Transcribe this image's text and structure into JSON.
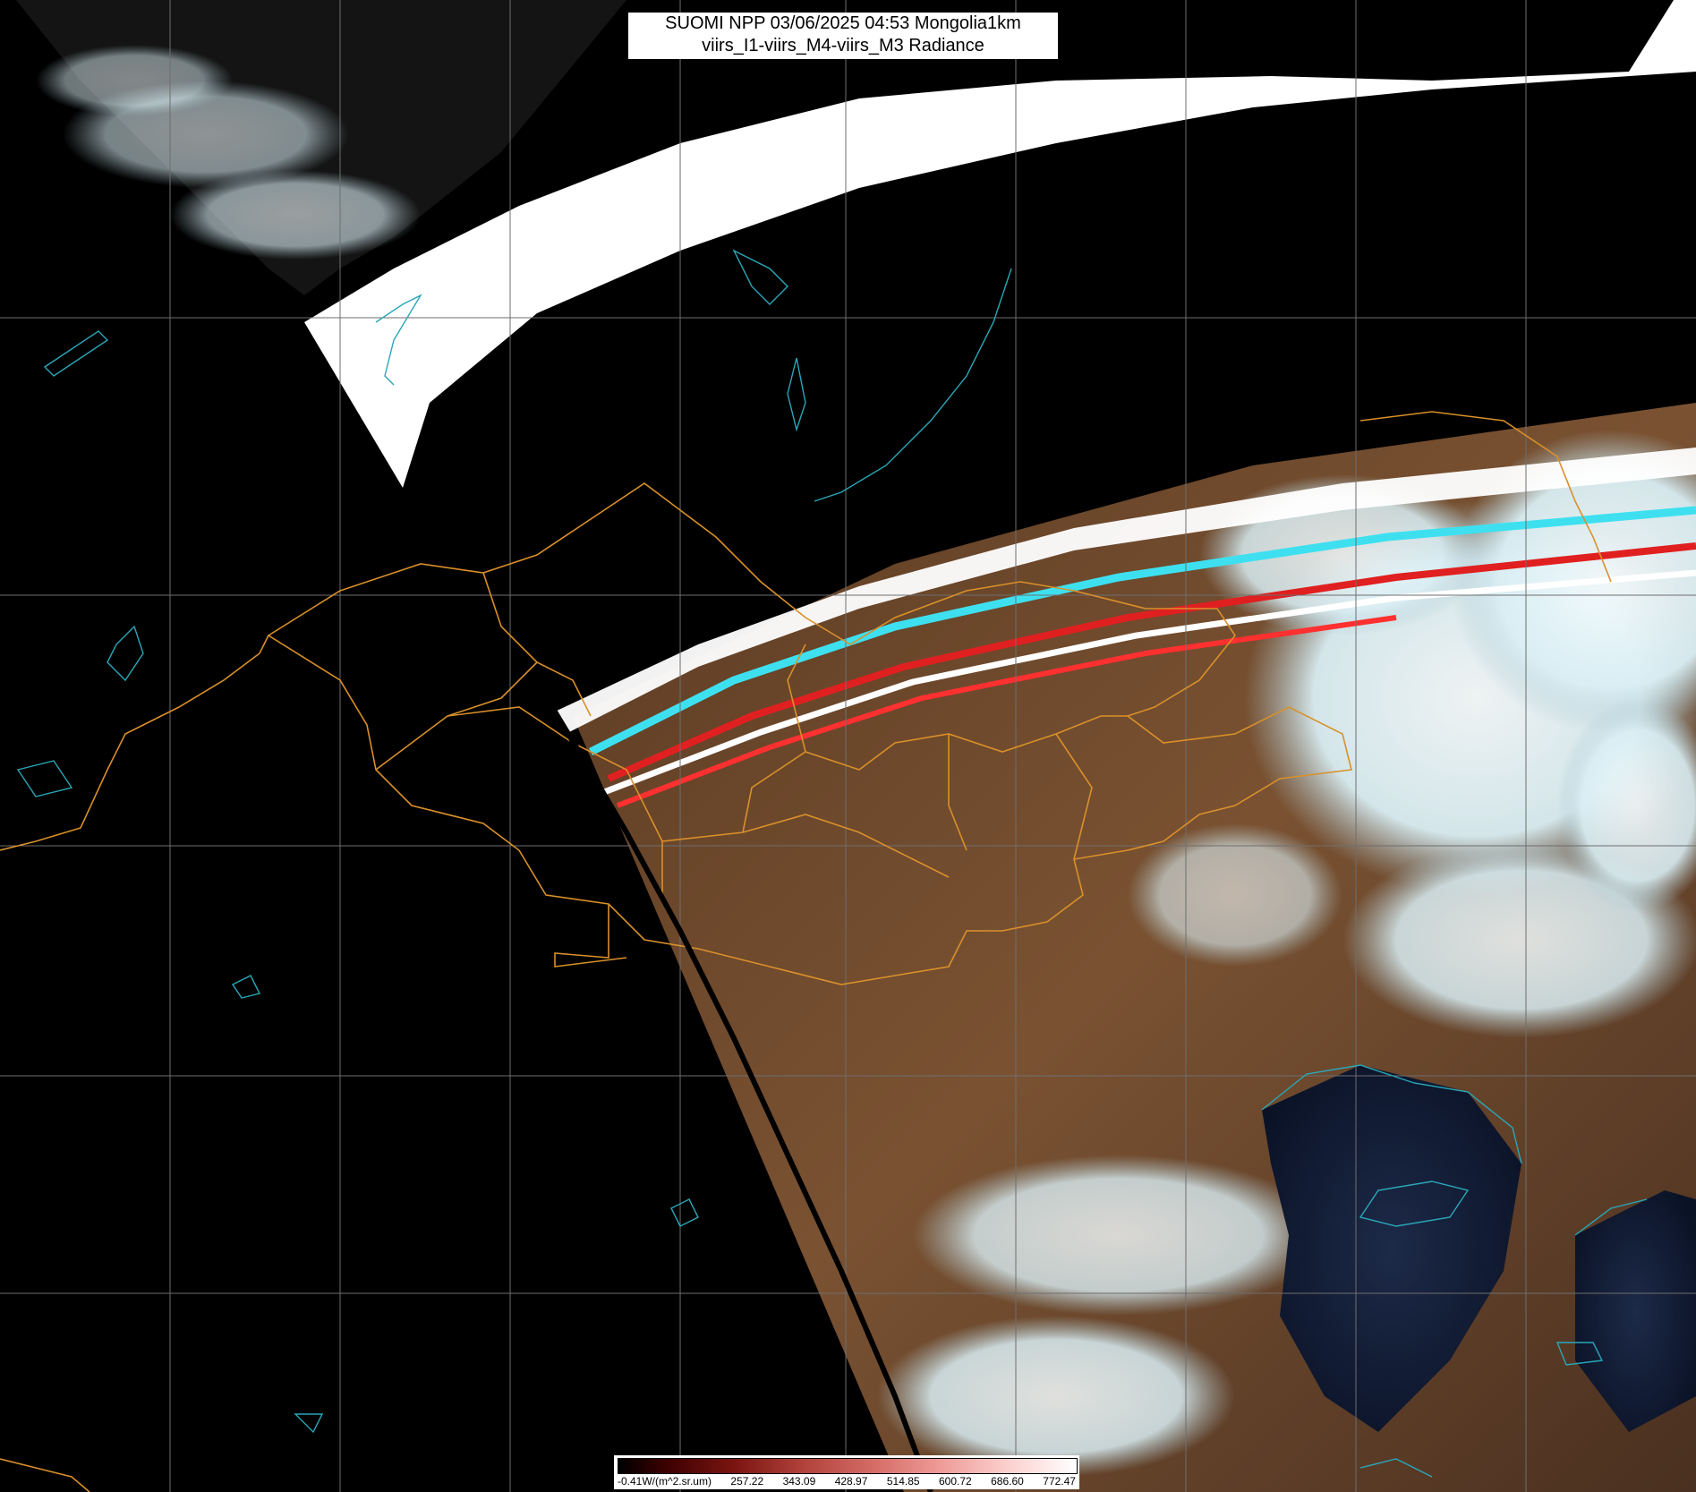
{
  "title": {
    "line1": "SUOMI NPP 03/06/2025 04:53 Mongolia1km",
    "line2": "viirs_I1-viirs_M4-viirs_M3 Radiance"
  },
  "legend": {
    "ticks": [
      "-0.41W/(m^2.sr.um)",
      "257.22",
      "343.09",
      "428.97",
      "514.85",
      "600.72",
      "686.60",
      "772.47"
    ]
  },
  "colors": {
    "background": "#000000",
    "land": "#6b4a2e",
    "cloud": "#e8f6fb",
    "border_lines": "#d9902a",
    "coast_lines": "#2aa7b8",
    "grid_lines": "#6e6e6e",
    "stripe_cyan": "#3ee0f0",
    "stripe_red": "#e02020"
  }
}
